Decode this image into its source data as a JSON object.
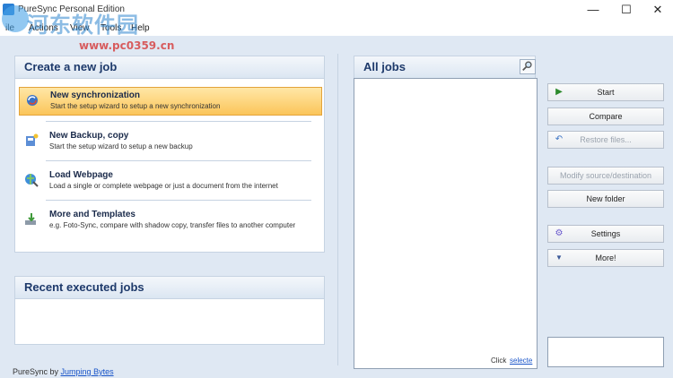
{
  "window": {
    "title": "PureSync Personal Edition",
    "controls": {
      "minimize": "—",
      "maximize": "☐",
      "close": "✕"
    }
  },
  "menu": [
    {
      "label": "ile"
    },
    {
      "label": "Actions"
    },
    {
      "label": "View"
    },
    {
      "label": "Tools"
    },
    {
      "label": "Help"
    }
  ],
  "watermark": {
    "text": "河东软件园",
    "url": "www.pc0359.cn"
  },
  "create_panel": {
    "title": "Create a new job",
    "items": [
      {
        "title": "New synchronization",
        "desc": "Start the setup wizard to setup a new synchronization",
        "icon": "sync-icon",
        "selected": true
      },
      {
        "title": "New Backup, copy",
        "desc": "Start the setup wizard to setup a new backup",
        "icon": "backup-icon",
        "selected": false
      },
      {
        "title": "Load Webpage",
        "desc": "Load a single or complete webpage or just a document from the internet",
        "icon": "globe-icon",
        "selected": false
      },
      {
        "title": "More and Templates",
        "desc": "e.g. Foto-Sync, compare with shadow copy, transfer files to another computer",
        "icon": "templates-icon",
        "selected": false
      }
    ]
  },
  "recent_panel": {
    "title": "Recent executed jobs"
  },
  "all_jobs": {
    "title": "All jobs",
    "footer_text": "Click",
    "footer_link": "selecte"
  },
  "buttons": {
    "start": "Start",
    "compare": "Compare",
    "restore": "Restore files...",
    "modify": "Modify source/destination",
    "new_folder": "New folder",
    "settings": "Settings",
    "more": "More!"
  },
  "footer": {
    "text": "PureSync by",
    "link": "Jumping Bytes"
  },
  "colors": {
    "accent": "#1e3a6b",
    "selection": "#fbc55a",
    "background": "#dfe8f3"
  }
}
